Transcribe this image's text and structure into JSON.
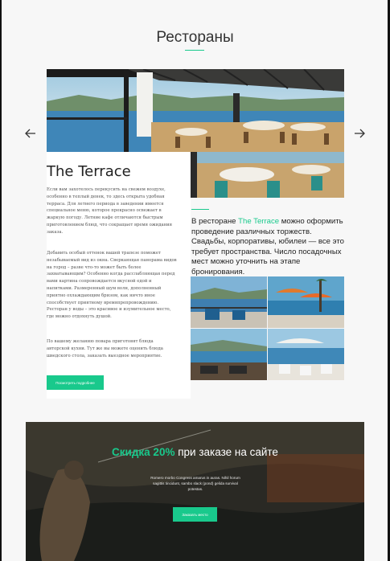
{
  "section_title": "Рестораны",
  "nav": {
    "prev_icon": "arrow-left-icon",
    "next_icon": "arrow-right-icon"
  },
  "card": {
    "name": "The Terrace",
    "paragraphs": [
      "Если вам захотелось перекусить на свежем воздухе, особенно в теплый денек, то здесь открыта удобная терраса. Для летнего периода в заведении имеется специальное меню, которое прекрасно освежает в жаркую погоду. Летние кафе отличаются быстрым приготовлением блюд, что сокращает время ожидания заказа.",
      "Добавить особый оттенок вашей трапезе поможет незабываемый вид из окна. Сверкающая панорама видов на город – разве что-то может быть более захватывающим? Особенно когда расслабляющая перед вами картина сопровождается вкусной едой и напитками. Размеренный шум волн, дополненный приятно охлаждающим бризом, как ничто иное способствует приятному времяпрепровождению. Ресторан у воды – это красивое и изумительное место, где можно отдохнуть душой.",
      "По вашему желанию повара приготовят блюда авторской кухни. Тут же вы можете оценить блюда шведского стола, заказать выездное мероприятие."
    ],
    "button_label": "Посмотреть подробнее"
  },
  "side": {
    "lead_prefix": "В ресторане ",
    "lead_accent": "The Terrace",
    "lead_suffix": " можно оформить проведение различных торжеств. Свадьбы, корпоративы, юбилеи — все это требует пространства. Число посадочных мест можно уточнить на этапе бронирования."
  },
  "promo": {
    "title_accent": "Скидка 20%",
    "title_rest": " при заказе на сайте",
    "text": "Romero morbo Congress amarus in auras. Nihil horum sagittis tincidunt, sambo slack (pond) gelida survival potestas.",
    "button_label": "Заказать место"
  },
  "colors": {
    "accent": "#19c98c",
    "background": "#f7f7f7",
    "text": "#222222"
  }
}
